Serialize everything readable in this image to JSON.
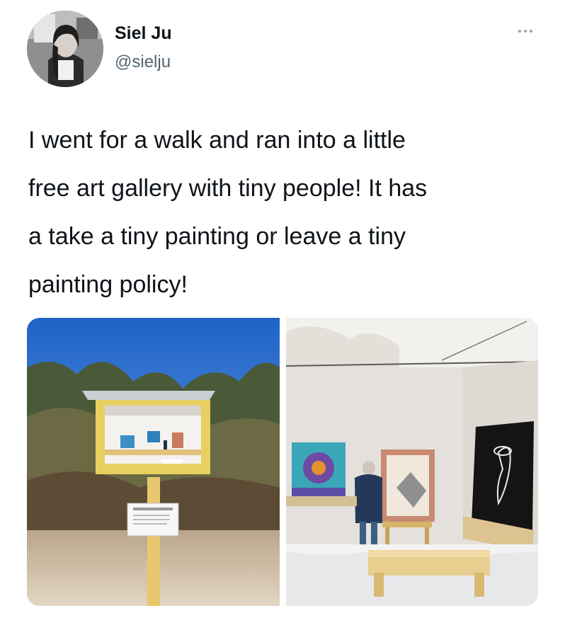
{
  "tweet": {
    "author": {
      "display_name": "Siel Ju",
      "handle": "@sielju"
    },
    "text": "I went for a walk and ran into a little\nfree art gallery with tiny people! It has\na take a tiny painting or leave a tiny\npainting policy!",
    "media": [
      {
        "icon": "photo-little-free-art-gallery-box"
      },
      {
        "icon": "photo-tiny-gallery-interior"
      }
    ]
  },
  "colors": {
    "text_primary": "#0f1419",
    "text_secondary": "#536471",
    "background": "#ffffff"
  }
}
